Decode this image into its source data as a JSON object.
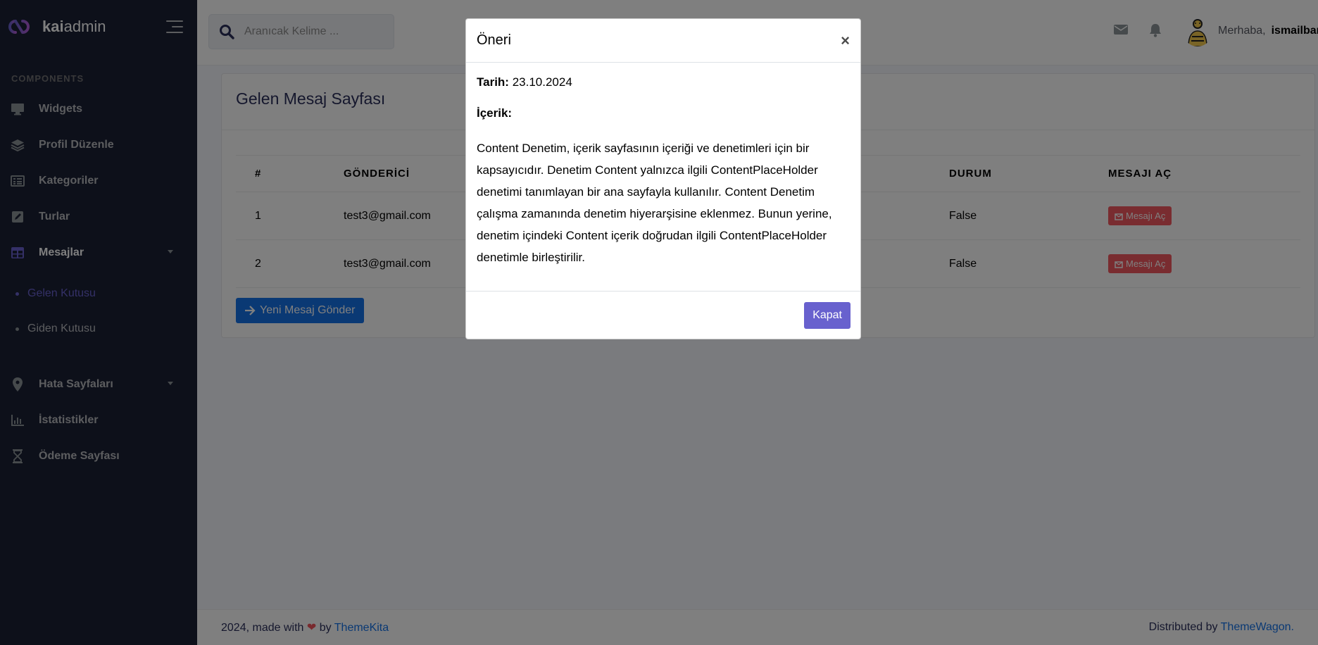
{
  "sidebar": {
    "logo": {
      "brand_bold": "kai",
      "brand_light": "admin"
    },
    "section_title": "COMPONENTS",
    "items": [
      {
        "label": "Widgets",
        "icon": "desktop-icon"
      },
      {
        "label": "Profil Düzenle",
        "icon": "layers-icon"
      },
      {
        "label": "Kategoriler",
        "icon": "list-icon"
      },
      {
        "label": "Turlar",
        "icon": "pen-square-icon"
      },
      {
        "label": "Mesajlar",
        "icon": "table-icon",
        "active": true
      },
      {
        "label": "Hata Sayfaları",
        "icon": "map-marker-icon"
      },
      {
        "label": "İstatistikler",
        "icon": "chart-icon"
      },
      {
        "label": "Ödeme Sayfası",
        "icon": "hourglass-icon"
      }
    ],
    "subitems": [
      {
        "label": "Gelen Kutusu",
        "active": true
      },
      {
        "label": "Giden Kutusu"
      }
    ]
  },
  "topbar": {
    "search_placeholder": "Aranıcak Kelime ...",
    "greeting": "Merhaba,",
    "username": "ismailbar"
  },
  "main": {
    "title": "Gelen Mesaj Sayfası",
    "table": {
      "headers": [
        "#",
        "GÖNDERİCİ",
        "DURUM",
        "MESAJI AÇ"
      ],
      "rows": [
        {
          "id": "1",
          "sender": "test3@gmail.com",
          "status": "False",
          "action": "Mesajı Aç"
        },
        {
          "id": "2",
          "sender": "test3@gmail.com",
          "status": "False",
          "action": "Mesajı Aç"
        }
      ]
    },
    "new_message_button": "Yeni Mesaj Gönder"
  },
  "footer": {
    "left_text": "2024, made with",
    "by": "by",
    "left_link": "ThemeKita",
    "right_text": "Distributed by",
    "right_link": "ThemeWagon."
  },
  "modal": {
    "title": "Öneri",
    "close_symbol": "×",
    "date_label": "Tarih:",
    "date_value": "23.10.2024",
    "content_label": "İçerik:",
    "content_text": "Content Denetim, içerik sayfasının içeriği ve denetimleri için bir kapsayıcıdır. Denetim Content yalnızca ilgili ContentPlaceHolder denetimi tanımlayan bir ana sayfayla kullanılır. Content Denetim çalışma zamanında denetim hiyerarşisine eklenmez. Bunun yerine, denetim içindeki Content içerik doğrudan ilgili ContentPlaceHolder denetimle birleştirilir.",
    "close_button": "Kapat"
  },
  "colors": {
    "sidebar_bg": "#1a2035",
    "accent": "#6861ce",
    "primary": "#1572e8",
    "danger": "#f25961"
  }
}
